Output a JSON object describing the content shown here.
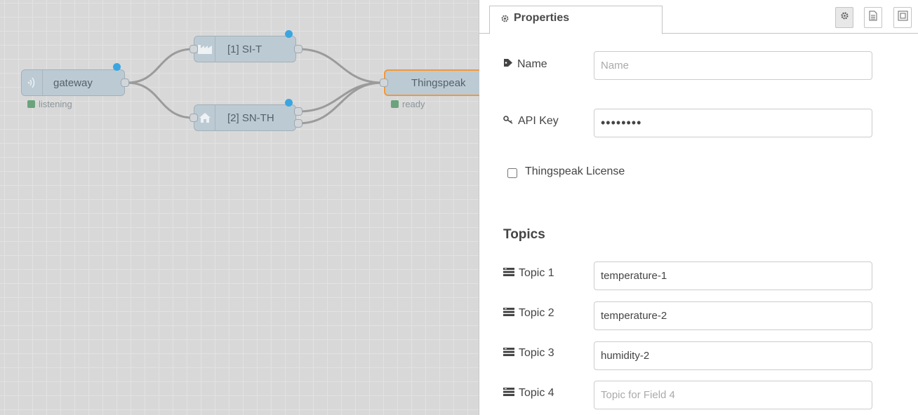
{
  "canvas": {
    "nodes": {
      "gateway": {
        "label": "gateway",
        "status": "listening",
        "icon": "wifi-icon"
      },
      "si_t": {
        "label": "[1] SI-T",
        "icon": "factory-icon"
      },
      "sn_th": {
        "label": "[2] SN-TH",
        "icon": "home-icon"
      },
      "thingspeak": {
        "label": "Thingspeak",
        "status": "ready"
      }
    },
    "colors": {
      "node_fill": "#bccad4",
      "changed_dot": "#3aa6e0",
      "status_ok": "#6ba37d",
      "selected_outline": "#f0983c"
    }
  },
  "panel": {
    "tab_label": "Properties",
    "tab_icon": "gear-icon",
    "toolbar_icons": [
      "gear-icon",
      "document-icon",
      "layout-icon"
    ],
    "fields": {
      "name": {
        "label": "Name",
        "value": "",
        "placeholder": "Name",
        "icon": "tag-icon"
      },
      "api_key": {
        "label": "API Key",
        "value": "••••••••",
        "icon": "key-icon"
      }
    },
    "license": {
      "label": "Thingspeak License",
      "checked": false
    },
    "topics_heading": "Topics",
    "topics": [
      {
        "label": "Topic 1",
        "value": "temperature-1",
        "placeholder": ""
      },
      {
        "label": "Topic 2",
        "value": "temperature-2",
        "placeholder": ""
      },
      {
        "label": "Topic 3",
        "value": "humidity-2",
        "placeholder": ""
      },
      {
        "label": "Topic 4",
        "value": "",
        "placeholder": "Topic for Field 4"
      }
    ]
  }
}
